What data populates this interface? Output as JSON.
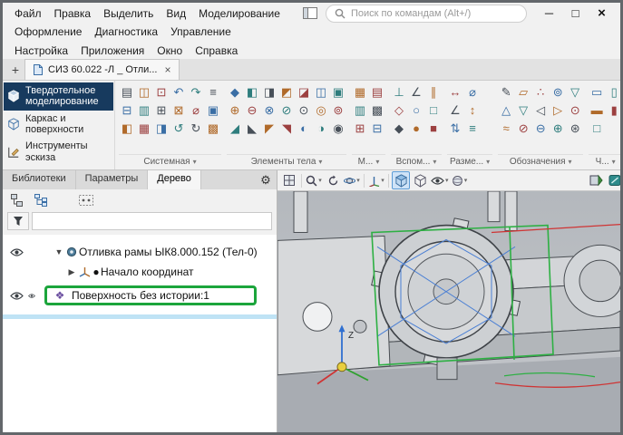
{
  "colors": {
    "accent_green": "#1ca53c",
    "mode_active": "#173a5e",
    "selection_blue": "#bfe3f5",
    "tab_active_bg": "#f7f7f7"
  },
  "menu": {
    "row1": [
      "Файл",
      "Правка",
      "Выделить",
      "Вид",
      "Моделирование"
    ],
    "row2": [
      "Оформление",
      "Диагностика",
      "Управление"
    ],
    "row3": [
      "Настройка",
      "Приложения",
      "Окно",
      "Справка"
    ]
  },
  "search": {
    "placeholder": "Поиск по командам (Alt+/)"
  },
  "window_controls": {
    "minimize": "─",
    "maximize": "□",
    "close": "×"
  },
  "tabbar": {
    "add": "+",
    "tab_title": "СИЗ 60.022 -Л _ Отли...",
    "close": "×"
  },
  "modes": [
    {
      "label": "Твердотельное моделирование",
      "active": true
    },
    {
      "label": "Каркас и поверхности",
      "active": false
    },
    {
      "label": "Инструменты эскиза",
      "active": false
    }
  ],
  "ribbon": {
    "groups": [
      {
        "label": "Системная",
        "rows": [
          [
            "▤",
            "◫",
            "⊡",
            "↶",
            "↷",
            "≡"
          ],
          [
            "⊟",
            "▥",
            "⊞",
            "⊠",
            "⌀",
            "▣"
          ],
          [
            "◧",
            "▦",
            "◨",
            "↺",
            "↻",
            "▩"
          ]
        ]
      },
      {
        "label": "Элементы тела",
        "rows": [
          [
            "◆",
            "◧",
            "◨",
            "◩",
            "◪",
            "◫",
            "▣"
          ],
          [
            "⊕",
            "⊖",
            "⊗",
            "⊘",
            "⊙",
            "◎",
            "⊚"
          ],
          [
            "◢",
            "◣",
            "◤",
            "◥",
            "◐",
            "◑",
            "◉"
          ]
        ]
      },
      {
        "label": "М...",
        "rows": [
          [
            "▦",
            "▤"
          ],
          [
            "▥",
            "▩"
          ],
          [
            "⊞",
            "⊟"
          ]
        ]
      },
      {
        "label": "Вспом...",
        "rows": [
          [
            "⊥",
            "∠",
            "∥"
          ],
          [
            "◇",
            "○",
            "□"
          ],
          [
            "◆",
            "●",
            "■"
          ]
        ]
      },
      {
        "label": "Разме...",
        "rows": [
          [
            "↔",
            "⌀"
          ],
          [
            "∠",
            "↕"
          ],
          [
            "⇅",
            "≡"
          ]
        ]
      },
      {
        "label": "Обозначения",
        "rows": [
          [
            "✎",
            "▱",
            "∴",
            "⊚",
            "▽"
          ],
          [
            "△",
            "▽",
            "◁",
            "▷",
            "⊙"
          ],
          [
            "≈",
            "⊘",
            "⊖",
            "⊕",
            "⊛"
          ]
        ]
      },
      {
        "label": "Ч...",
        "rows": [
          [
            "▭",
            "▯"
          ],
          [
            "▬",
            "▮"
          ],
          [
            "□"
          ]
        ]
      }
    ]
  },
  "panel": {
    "tabs": [
      {
        "label": "Библиотеки",
        "active": false
      },
      {
        "label": "Параметры",
        "active": false
      },
      {
        "label": "Дерево",
        "active": true
      }
    ],
    "filter_value": "",
    "tree": {
      "root": "Отливка рамы ЫК8.000.152 (Тел-0)",
      "origin": "Начало координат",
      "surface": "Поверхность без истории:1"
    }
  },
  "icons": {
    "chevron": "▾",
    "expander_open": "▼",
    "expander_closed": "▶",
    "bullet": "●",
    "gear": "⚙",
    "surface_glyph": "❖"
  },
  "viewport": {
    "axis_z": "Z"
  }
}
